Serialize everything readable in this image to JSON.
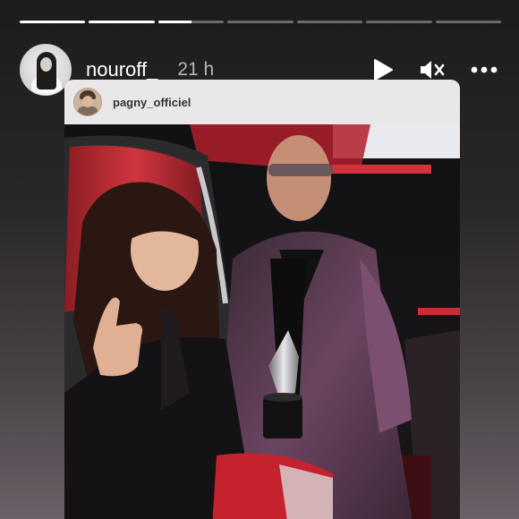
{
  "story": {
    "progress_segments": [
      1,
      1,
      0.5,
      0,
      0,
      0,
      0
    ],
    "username": "nouroff_",
    "timestamp": "21 h",
    "icons": {
      "play": "play-icon",
      "mute": "muted-speaker-icon",
      "more": "more-icon"
    }
  },
  "shared_post": {
    "username": "pagny_officiel"
  },
  "colors": {
    "background_top": "#1c1b1d",
    "background_bottom": "#6b6168",
    "card": "#e9e7e8",
    "jacket": "#5a3d52",
    "chair_red": "#c9303a"
  }
}
